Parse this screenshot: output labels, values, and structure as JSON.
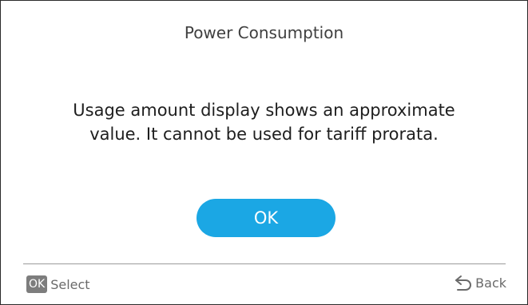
{
  "dialog": {
    "title": "Power Consumption",
    "message": "Usage amount display shows an approximate value. It cannot be used for tariff prorata.",
    "ok_label": "OK"
  },
  "footer": {
    "select_key": "OK",
    "select_label": "Select",
    "back_label": "Back",
    "back_icon": "back-arrow-icon"
  },
  "colors": {
    "accent": "#1ba7e4",
    "key_badge": "#7d7d7d"
  }
}
